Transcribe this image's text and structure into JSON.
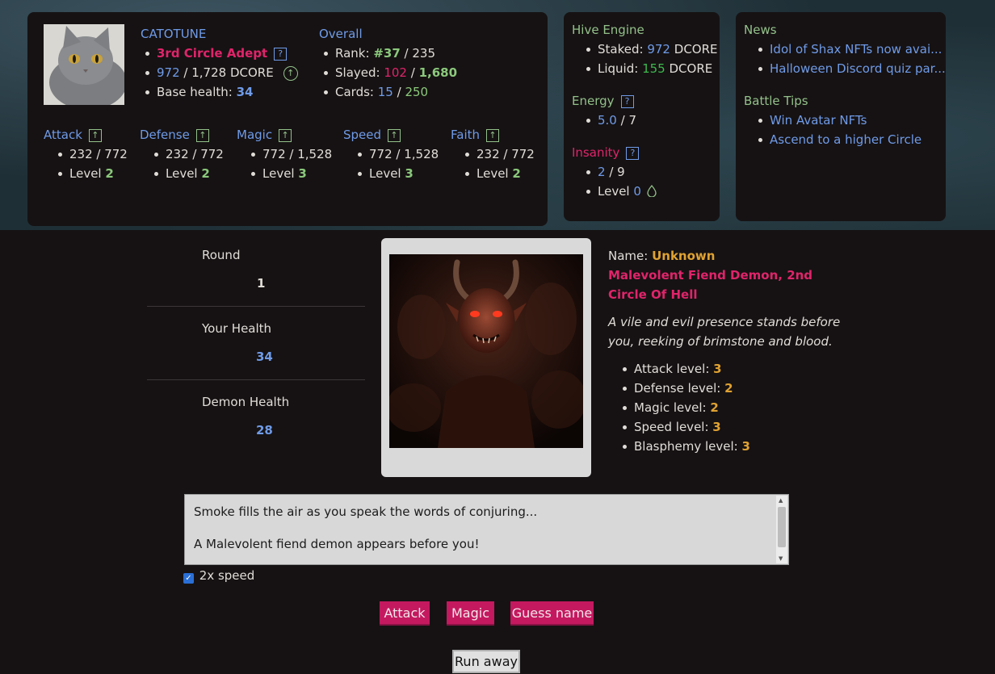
{
  "player": {
    "name": "CATOTUNE",
    "title": "3rd Circle Adept",
    "dcore_current": "972",
    "dcore_max": "1,728 DCORE",
    "base_health_label": "Base health:",
    "base_health": "34"
  },
  "overall": {
    "heading": "Overall",
    "rank_label": "Rank:",
    "rank": "#37",
    "rank_total": "235",
    "slayed_label": "Slayed:",
    "slayed": "102",
    "slayed_total": "1,680",
    "cards_label": "Cards:",
    "cards": "15",
    "cards_total": "250"
  },
  "stats": [
    {
      "name": "Attack",
      "value": "232 / 772",
      "level_label": "Level",
      "level": "2"
    },
    {
      "name": "Defense",
      "value": "232 / 772",
      "level_label": "Level",
      "level": "2"
    },
    {
      "name": "Magic",
      "value": "772 / 1,528",
      "level_label": "Level",
      "level": "3"
    },
    {
      "name": "Speed",
      "value": "772 / 1,528",
      "level_label": "Level",
      "level": "3"
    },
    {
      "name": "Faith",
      "value": "232 / 772",
      "level_label": "Level",
      "level": "2"
    }
  ],
  "hive": {
    "heading": "Hive Engine",
    "staked_label": "Staked:",
    "staked": "972",
    "staked_unit": "DCORE",
    "liquid_label": "Liquid:",
    "liquid": "155",
    "liquid_unit": "DCORE"
  },
  "energy": {
    "heading": "Energy",
    "current": "5.0",
    "max": "7"
  },
  "insanity": {
    "heading": "Insanity",
    "current": "2",
    "max": "9",
    "level_label": "Level",
    "level": "0"
  },
  "news": {
    "heading": "News",
    "items": [
      "Idol of Shax NFTs now avai...",
      "Halloween Discord quiz par..."
    ]
  },
  "tips": {
    "heading": "Battle Tips",
    "items": [
      "Win Avatar NFTs",
      "Ascend to a higher Circle"
    ]
  },
  "battle": {
    "round_label": "Round",
    "round": "1",
    "your_health_label": "Your Health",
    "your_health": "34",
    "demon_health_label": "Demon Health",
    "demon_health": "28"
  },
  "demon": {
    "name_label": "Name:",
    "name": "Unknown",
    "title_line1": "Malevolent Fiend Demon, 2nd",
    "title_line2": "Circle Of Hell",
    "desc_line1": "A vile and evil presence stands before",
    "desc_line2": "you, reeking of brimstone and blood.",
    "levels": [
      {
        "label": "Attack level:",
        "value": "3"
      },
      {
        "label": "Defense level:",
        "value": "2"
      },
      {
        "label": "Magic level:",
        "value": "2"
      },
      {
        "label": "Speed level:",
        "value": "3"
      },
      {
        "label": "Blasphemy level:",
        "value": "3"
      }
    ]
  },
  "log": {
    "lines": [
      "Smoke fills the air as you speak the words of conjuring...",
      "A Malevolent fiend demon appears before you!"
    ]
  },
  "controls": {
    "speed_label": "2x speed",
    "speed_checked": true,
    "attack": "Attack",
    "magic": "Magic",
    "guess": "Guess name",
    "run": "Run away"
  },
  "colors": {
    "accent_pink": "#c4195f",
    "link_blue": "#6f9be8",
    "level_green": "#8bc97c",
    "demon_orange": "#e0a232"
  },
  "icons": {
    "help": "?",
    "upgrade": "↑",
    "drop": "droplet"
  }
}
